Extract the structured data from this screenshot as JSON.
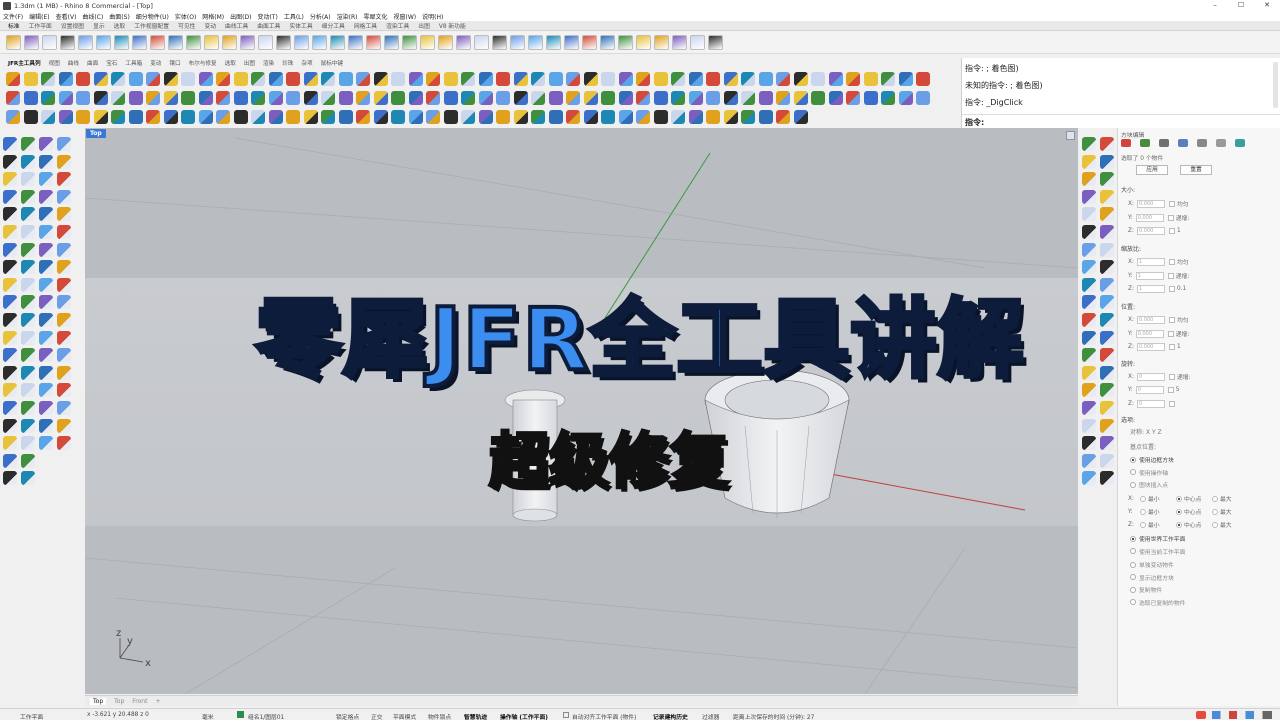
{
  "window": {
    "title": "1.3dm (1 MB) - Rhino 8 Commercial - [Top]",
    "controls": [
      "–",
      "☐",
      "✕"
    ]
  },
  "menu": [
    "文件(F)",
    "编辑(E)",
    "查看(V)",
    "曲线(C)",
    "曲面(S)",
    "细分物件(U)",
    "实体(O)",
    "网格(M)",
    "出图(D)",
    "变动(T)",
    "工具(L)",
    "分析(A)",
    "渲染(R)",
    "零犀文化",
    "视窗(W)",
    "说明(H)"
  ],
  "top_tabs": [
    "标准",
    "工作平面",
    "设置视图",
    "显示",
    "选取",
    "工作视窗配置",
    "可见性",
    "变动",
    "曲线工具",
    "曲面工具",
    "实体工具",
    "细分工具",
    "网格工具",
    "渲染工具",
    "出图",
    "V8 新功能"
  ],
  "jfr_tabs": [
    "JFR主工具列",
    "视图",
    "曲线",
    "曲面",
    "宝石",
    "工具箱",
    "变动",
    "镶口",
    "布尔与修复",
    "选取",
    "出图",
    "渲染",
    "珍珠",
    "杂项",
    "鼠标中键"
  ],
  "command_history": [
    "指令: ; 着色图)",
    "未知的指令: ; 着色图)",
    "指令: _DigClick"
  ],
  "command_prompt": "指令:",
  "viewport": {
    "name": "Top",
    "tabs": [
      "Top",
      "Top",
      "Front",
      "+"
    ],
    "axis_labels": {
      "x": "x",
      "y": "y",
      "z": "z"
    }
  },
  "banner": {
    "title": "零犀JFR全工具讲解",
    "subtitle": "超级修复"
  },
  "properties": {
    "header": "方块编辑",
    "selection": "选取了 0 个物件",
    "apply_button": "应用",
    "reset_button": "重置",
    "size_section": "大小:",
    "scale_section": "缩放比:",
    "position_section": "位置:",
    "rotation_section": "旋转:",
    "options_section": "选项:",
    "size_rows": [
      {
        "axis": "X:",
        "value": "0.000",
        "extra": "均匀"
      },
      {
        "axis": "Y:",
        "value": "0.000",
        "extra": "递增:"
      },
      {
        "axis": "Z:",
        "value": "0.000",
        "extra": "1"
      }
    ],
    "scale_rows": [
      {
        "axis": "X:",
        "value": "1",
        "extra": "均匀"
      },
      {
        "axis": "Y:",
        "value": "1",
        "extra": "递增:"
      },
      {
        "axis": "Z:",
        "value": "1",
        "extra": "0.1"
      }
    ],
    "position_rows": [
      {
        "axis": "X:",
        "value": "0.000",
        "extra": "均匀"
      },
      {
        "axis": "Y:",
        "value": "0.000",
        "extra": "递增:"
      },
      {
        "axis": "Z:",
        "value": "0.000",
        "extra": "1"
      }
    ],
    "rotation_rows": [
      {
        "axis": "X:",
        "value": "0",
        "extra": "递增:"
      },
      {
        "axis": "Y:",
        "value": "0",
        "extra": "5"
      },
      {
        "axis": "Z:",
        "value": "0",
        "extra": ""
      }
    ],
    "symmetry": "对称: X  Y  Z",
    "anchor_label": "基点位置:",
    "anchor_options": [
      "使用边框方块",
      "使用操作轴",
      "图块插入点"
    ],
    "anchor_selected": 0,
    "axis_grid": [
      {
        "axis": "X:",
        "opts": [
          "最小",
          "中心点",
          "最大"
        ]
      },
      {
        "axis": "Y:",
        "opts": [
          "最小",
          "中心点",
          "最大"
        ]
      },
      {
        "axis": "Z:",
        "opts": [
          "最小",
          "中心点",
          "最大"
        ]
      }
    ],
    "plane_options": [
      "使用世界工作平面",
      "使用当前工作平面"
    ],
    "plane_selected": 0,
    "misc_options": [
      "单独变动物件",
      "显示边框方块",
      "复制物件",
      "选取已复制的物件"
    ]
  },
  "statusbar": {
    "plane": "工作平面",
    "coords": "x -3.621  y 20.488  z 0",
    "unit": "毫米",
    "layer": "组名1/图层01",
    "toggles": [
      "锁定格点",
      "正交",
      "平面模式",
      "物件锁点",
      "智慧轨迹",
      "操作轴 (工作平面)",
      "自动对齐工作平面 (物件)",
      "记录建构历史",
      "过滤器"
    ],
    "save_info": "距离上次保存的时间 (分钟): 27"
  },
  "colors": {
    "viewport_bg": "#b8bcc1",
    "banner_blue": "#3b8df0",
    "banner_yellow": "#f7e520",
    "accent": "#3a78d6"
  }
}
